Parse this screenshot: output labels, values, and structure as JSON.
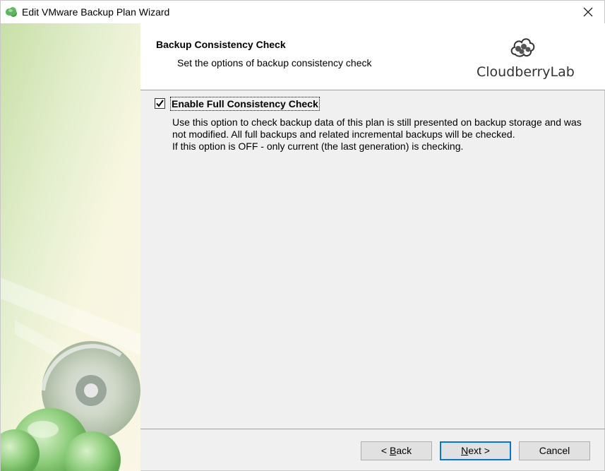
{
  "window": {
    "title": "Edit VMware Backup Plan Wizard"
  },
  "header": {
    "title": "Backup Consistency Check",
    "subtitle": "Set the options of backup consistency check",
    "logo_text": "CloudberryLab"
  },
  "option": {
    "label": "Enable Full Consistency Check",
    "checked": true,
    "description": [
      "Use this option to check backup data of this plan is still presented on backup storage and was",
      "not modified. All full backups and related incremental backups will be checked.",
      "If this option is OFF - only current (the last generation) is checking."
    ]
  },
  "buttons": {
    "back_prefix": "< ",
    "back_mnemonic": "B",
    "back_rest": "ack",
    "next_mnemonic": "N",
    "next_rest": "ext >",
    "cancel": "Cancel"
  },
  "colors": {
    "accent": "#0078d7",
    "side_green": "#cfe3b0"
  }
}
